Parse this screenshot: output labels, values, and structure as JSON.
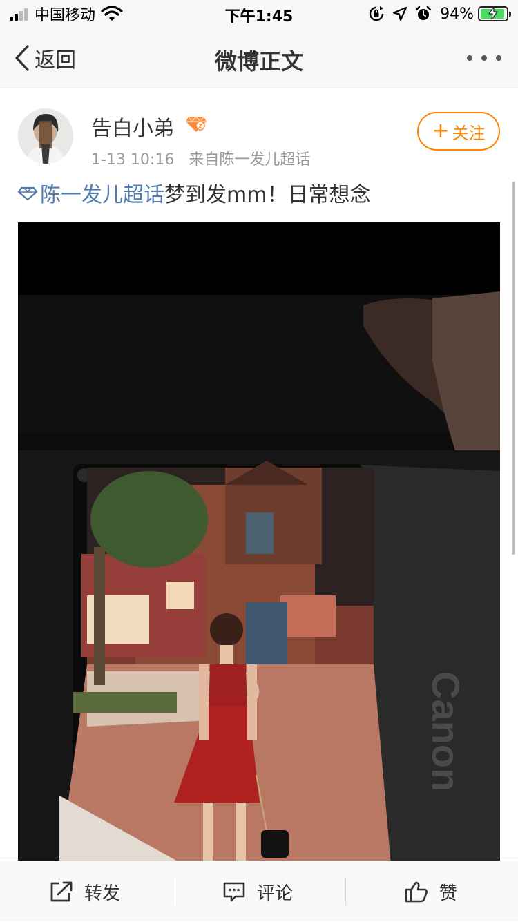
{
  "status_bar": {
    "carrier": "中国移动",
    "time": "下午1:45",
    "battery_percent": "94%",
    "battery_level": 0.94,
    "icons": [
      "signal-icon",
      "wifi-icon",
      "orientation-lock-icon",
      "location-icon",
      "alarm-icon",
      "battery-charging-icon"
    ]
  },
  "nav": {
    "back_label": "返回",
    "title": "微博正文",
    "more_icon": "more-dots-icon"
  },
  "post": {
    "author": "告白小弟",
    "author_badge_icon": "vip-diamond-badge-icon",
    "timestamp": "1-13 10:16",
    "source": "来自陈一发儿超话",
    "follow_plus": "+",
    "follow_label": "关注",
    "topic_icon": "supertopic-diamond-icon",
    "topic": "陈一发儿超话",
    "text": "梦到发mm！日常想念",
    "image": "photo-of-camera-screen-showing-woman-in-red-dress"
  },
  "actions": {
    "repost_label": "转发",
    "comment_label": "评论",
    "like_label": "赞"
  },
  "colors": {
    "accent_orange": "#ff8200",
    "link_blue": "#507daf",
    "bar_background": "#f7f7f7",
    "battery_green": "#4cd964"
  }
}
